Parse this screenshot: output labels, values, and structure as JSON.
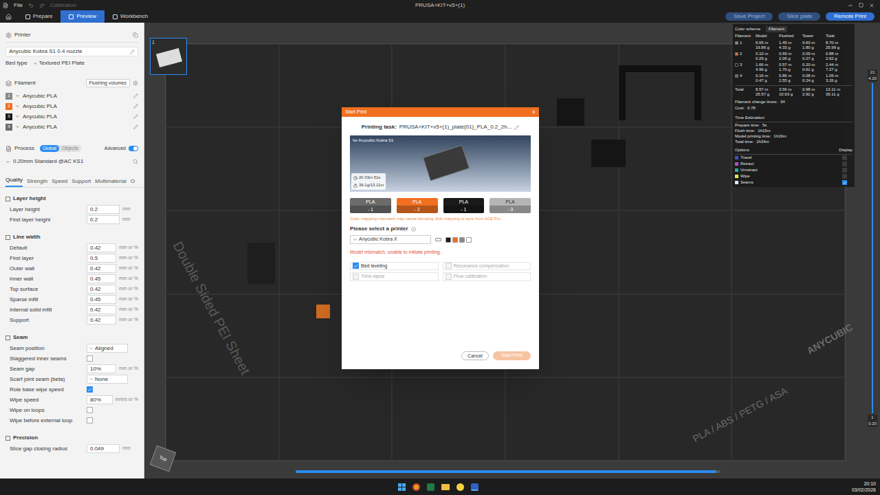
{
  "window": {
    "title": "PRUSA+KIT+v5+(1)",
    "menu": "File",
    "calibration": "Calibration"
  },
  "tabs": [
    {
      "label": "Prepare",
      "selected": false
    },
    {
      "label": "Preview",
      "selected": true
    },
    {
      "label": "Workbench",
      "selected": false
    }
  ],
  "toolbar_buttons": [
    {
      "label": "Save Project",
      "primary": false
    },
    {
      "label": "Slice plate",
      "primary": false
    },
    {
      "label": "Remote Print",
      "primary": true
    }
  ],
  "sidebar": {
    "printer": {
      "header": "Printer",
      "name": "Anycubic Kobra S1 0.4 nozzle",
      "bed_label": "Bed type",
      "bed_value": "Textured PEI Plate"
    },
    "filament": {
      "header": "Filament",
      "flush_button": "Flushing volumes",
      "items": [
        {
          "index": "1",
          "name": "Anycubic PLA",
          "color": "#8a8a8a"
        },
        {
          "index": "2",
          "name": "Anycubic PLA",
          "color": "#f07020"
        },
        {
          "index": "3",
          "name": "Anycubic PLA",
          "color": "#1a1a1a"
        },
        {
          "index": "4",
          "name": "Anycubic PLA",
          "color": "#6e6e6e"
        }
      ]
    },
    "process": {
      "header": "Process",
      "scopes": [
        {
          "label": "Global",
          "selected": true
        },
        {
          "label": "Objects",
          "selected": false
        }
      ],
      "advanced_label": "Advanced",
      "advanced_on": true,
      "preset": "0.20mm Standard @AC KS1"
    },
    "settings_tabs": [
      {
        "label": "Quality",
        "selected": true
      },
      {
        "label": "Strength",
        "selected": false
      },
      {
        "label": "Speed",
        "selected": false
      },
      {
        "label": "Support",
        "selected": false
      },
      {
        "label": "Multimaterial",
        "selected": false
      },
      {
        "label": "O",
        "selected": false
      }
    ],
    "groups": [
      {
        "title": "Layer height",
        "rows": [
          {
            "kind": "input",
            "label": "Layer height",
            "value": "0.2",
            "unit": "mm"
          },
          {
            "kind": "input",
            "label": "First layer height",
            "value": "0.2",
            "unit": "mm"
          }
        ]
      },
      {
        "title": "Line width",
        "rows": [
          {
            "kind": "input",
            "label": "Default",
            "value": "0.42",
            "unit": "mm or %"
          },
          {
            "kind": "input",
            "label": "First layer",
            "value": "0.5",
            "unit": "mm or %"
          },
          {
            "kind": "input",
            "label": "Outer wall",
            "value": "0.42",
            "unit": "mm or %"
          },
          {
            "kind": "input",
            "label": "Inner wall",
            "value": "0.45",
            "unit": "mm or %"
          },
          {
            "kind": "input",
            "label": "Top surface",
            "value": "0.42",
            "unit": "mm or %"
          },
          {
            "kind": "input",
            "label": "Sparse infill",
            "value": "0.45",
            "unit": "mm or %"
          },
          {
            "kind": "input",
            "label": "Internal solid infill",
            "value": "0.42",
            "unit": "mm or %"
          },
          {
            "kind": "input",
            "label": "Support",
            "value": "0.42",
            "unit": "mm or %"
          }
        ]
      },
      {
        "title": "Seam",
        "rows": [
          {
            "kind": "select",
            "label": "Seam position",
            "value": "Aligned"
          },
          {
            "kind": "checkbox",
            "label": "Staggered inner seams",
            "checked": false
          },
          {
            "kind": "input",
            "label": "Seam gap",
            "value": "10%",
            "unit": "mm or %"
          },
          {
            "kind": "select",
            "label": "Scarf joint seam (beta)",
            "value": "None"
          },
          {
            "kind": "checkbox",
            "label": "Role base wipe speed",
            "checked": true
          },
          {
            "kind": "input",
            "label": "Wipe speed",
            "value": "80%",
            "unit": "mm/s or %"
          },
          {
            "kind": "checkbox",
            "label": "Wipe on loops",
            "checked": false
          },
          {
            "kind": "checkbox",
            "label": "Wipe before external loop",
            "checked": false
          }
        ]
      },
      {
        "title": "Precision",
        "rows": [
          {
            "kind": "input",
            "label": "Slice gap closing radius",
            "value": "0.049",
            "unit": "mm"
          }
        ]
      }
    ]
  },
  "plate": {
    "index": "1",
    "selected": true
  },
  "bed": {
    "sheet_label": "Double Sided PEI Sheet",
    "material_label": "PLA / ABS / PETG / ASA",
    "brand_label": "ANYCUBIC"
  },
  "view_cube": {
    "label": "Top"
  },
  "color_scheme": {
    "title": "Color scheme",
    "mode": "Filament",
    "columns": [
      "Filament",
      "Model",
      "Flushed",
      "Tower",
      "Total"
    ],
    "rows": [
      {
        "index": "1",
        "color": "#8a8a8a",
        "cells": [
          [
            "6.65 m",
            "19.86 g"
          ],
          [
            "1.45 m",
            "4.33 g"
          ],
          [
            "0.60 m",
            "1.80 g"
          ],
          [
            "8.70 m",
            "25.99 g"
          ]
        ]
      },
      {
        "index": "2",
        "color": "#f07020",
        "cells": [
          [
            "0.10 m",
            "0.29 g"
          ],
          [
            "0.69 m",
            "2.06 g"
          ],
          [
            "0.09 m",
            "0.27 g"
          ],
          [
            "0.88 m",
            "2.62 g"
          ]
        ]
      },
      {
        "index": "3",
        "color": "#1a1a1a",
        "cells": [
          [
            "1.66 m",
            "4.96 g"
          ],
          [
            "0.57 m",
            "1.70 g"
          ],
          [
            "0.20 m",
            "0.61 g"
          ],
          [
            "2.44 m",
            "7.27 g"
          ]
        ]
      },
      {
        "index": "4",
        "color": "#6e6e6e",
        "cells": [
          [
            "0.16 m",
            "0.47 g"
          ],
          [
            "0.86 m",
            "2.55 g"
          ],
          [
            "0.08 m",
            "0.24 g"
          ],
          [
            "1.09 m",
            "3.26 g"
          ]
        ]
      }
    ],
    "total": {
      "label": "Total",
      "cells": [
        [
          "8.57 m",
          "25.57 g"
        ],
        [
          "3.56 m",
          "10.63 g"
        ],
        [
          "0.98 m",
          "2.92 g"
        ],
        [
          "13.11 m",
          "39.11 g"
        ]
      ]
    },
    "change_times": {
      "label": "Filament change times:",
      "value": "34"
    },
    "cost": {
      "label": "Cost:",
      "value": "0.78"
    }
  },
  "time_estimation": {
    "title": "Time Estimation",
    "rows": [
      {
        "label": "Prepare time:",
        "value": "5s"
      },
      {
        "label": "Flush time:",
        "value": "1h15m"
      },
      {
        "label": "Model printing time:",
        "value": "1h19m"
      },
      {
        "label": "Total time:",
        "value": "2h34m"
      }
    ]
  },
  "options": {
    "header": "Options",
    "display_header": "Display",
    "items": [
      {
        "label": "Travel",
        "color": "#3f4fb8",
        "checked": false
      },
      {
        "label": "Retract",
        "color": "#b34ec5",
        "checked": false
      },
      {
        "label": "Unretract",
        "color": "#2fa6a6",
        "checked": false
      },
      {
        "label": "Wipe",
        "color": "#e6e64d",
        "checked": false
      },
      {
        "label": "Seams",
        "color": "#e6e6e6",
        "checked": true
      }
    ]
  },
  "layer_slider": {
    "top_layer": "21",
    "top_height": "4.20",
    "bottom_layer": "1",
    "bottom_height": "0.20",
    "level": 1
  },
  "move_slider": {
    "level": 0.99
  },
  "dialog": {
    "title": "Start Print",
    "close": "×",
    "task_label": "Printing task:",
    "task_name": "PRUSA+KIT+v5+(1)_plate(01)_PLA_0.2_2h...",
    "preview_for": "for Anycubic Kobra S1",
    "time": "2h 33m 51s",
    "weight": "39.1g/13.11m",
    "slots": [
      {
        "type": "PLA",
        "mapping": "- 1",
        "color": "#6b6b6b"
      },
      {
        "type": "PLA",
        "mapping": "- 2",
        "color": "#f07020"
      },
      {
        "type": "PLA",
        "mapping": "- 1",
        "color": "#1a1a1a"
      },
      {
        "type": "PLA",
        "mapping": "- 3",
        "color": "#b5b5b5"
      }
    ],
    "warning": "Color mapping mismatch may cause blending. Edit mapping or sync from ACE Pro.",
    "select_label": "Please select a printer",
    "printer": "Anycubic Kobra X",
    "ace_colors": [
      "#1a1a1a",
      "#f07020",
      "#8a8a8a",
      "#ffffff"
    ],
    "error": "Model mismatch, unable to initiate printing.",
    "options": [
      {
        "label": "Bed leveling",
        "checked": true,
        "disabled": false
      },
      {
        "label": "Resonance compensation",
        "checked": false,
        "disabled": true
      },
      {
        "label": "Time-lapse",
        "checked": false,
        "disabled": true
      },
      {
        "label": "Flow calibration",
        "checked": false,
        "disabled": true
      }
    ],
    "cancel": "Cancel",
    "start": "Start Print",
    "start_disabled": true
  },
  "taskbar": {
    "time": "20:10",
    "date": "03/02/2026"
  }
}
